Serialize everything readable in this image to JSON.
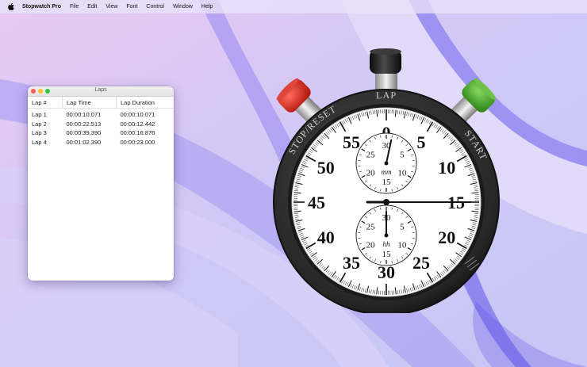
{
  "menu": {
    "app_name": "Stopwatch Pro",
    "items": [
      "File",
      "Edit",
      "View",
      "Font",
      "Control",
      "Window",
      "Help"
    ]
  },
  "laps_window": {
    "title": "Laps",
    "columns": [
      "Lap #",
      "Lap Time",
      "Lap Duration"
    ],
    "rows": [
      [
        "Lap 1",
        "00:00:10.071",
        "00:00:10.071"
      ],
      [
        "Lap 2",
        "00:00:22.513",
        "00:00:12.442"
      ],
      [
        "Lap 3",
        "00:00:39.390",
        "00:00:16.876"
      ],
      [
        "Lap 4",
        "00:01:02.390",
        "00:00:23.000"
      ]
    ]
  },
  "stopwatch": {
    "bezel_labels": {
      "left": "STOP/RESET",
      "top": "LAP",
      "right": "START"
    },
    "main_dial_numbers": [
      "0",
      "5",
      "10",
      "15",
      "20",
      "25",
      "30",
      "35",
      "40",
      "45",
      "50",
      "55"
    ],
    "minutes_subdial": {
      "numbers": [
        "30",
        "5",
        "10",
        "15",
        "20",
        "25"
      ],
      "unit": "mm"
    },
    "hours_subdial": {
      "numbers": [
        "30",
        "5",
        "10",
        "15",
        "20",
        "25"
      ],
      "unit": "hh"
    },
    "second_hand_seconds": 15,
    "minute_hand_minutes": 1,
    "hour_hand_hours": 0,
    "colors": {
      "stop_button": "#d42a1e",
      "lap_button": "#1a1a1a",
      "start_button": "#3f9e26",
      "bezel": "#2a2a2a",
      "dial": "#ffffff"
    }
  }
}
